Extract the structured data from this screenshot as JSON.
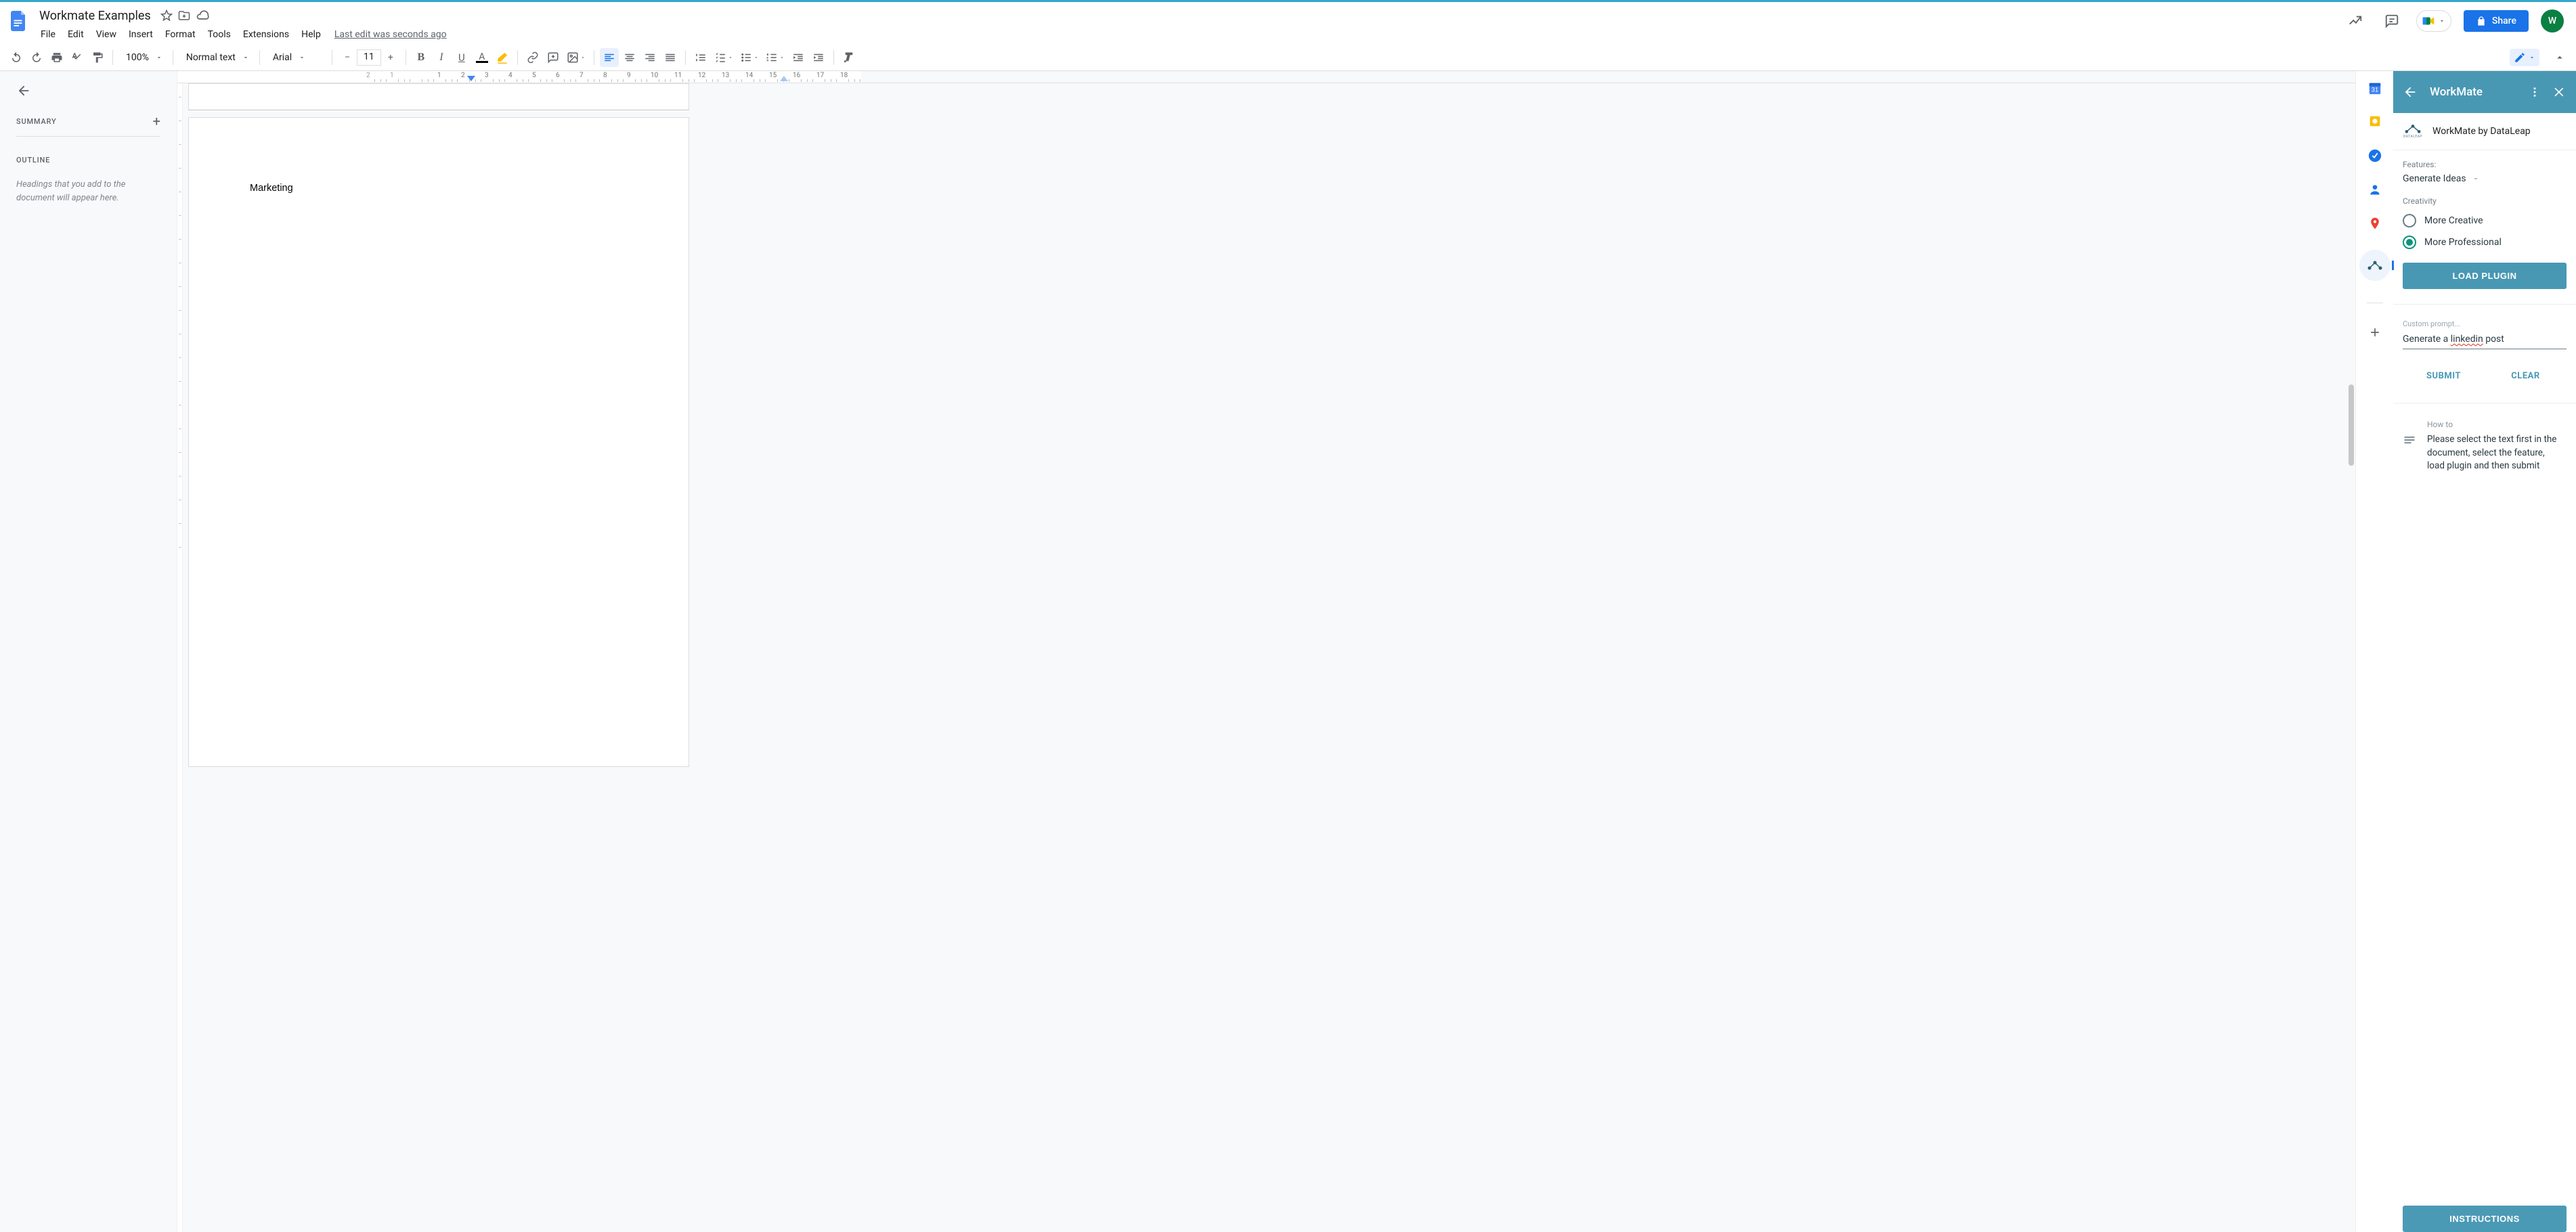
{
  "header": {
    "doc_title": "Workmate Examples",
    "menus": [
      "File",
      "Edit",
      "View",
      "Insert",
      "Format",
      "Tools",
      "Extensions",
      "Help"
    ],
    "last_edit": "Last edit was seconds ago",
    "share_label": "Share",
    "avatar_initial": "W"
  },
  "toolbar": {
    "zoom": "100%",
    "style": "Normal text",
    "font": "Arial",
    "font_size": "11"
  },
  "ruler": {
    "labels": [
      "2",
      "1",
      "",
      "1",
      "2",
      "3",
      "4",
      "5",
      "6",
      "7",
      "8",
      "9",
      "10",
      "11",
      "12",
      "13",
      "14",
      "15",
      "16",
      "17",
      "18"
    ]
  },
  "outline": {
    "summary_label": "SUMMARY",
    "outline_label": "OUTLINE",
    "hint": "Headings that you add to the document will appear here."
  },
  "document": {
    "body_text": "Marketing"
  },
  "rail": {
    "items": [
      "calendar",
      "keep",
      "tasks",
      "contacts",
      "maps",
      "workmate",
      "add"
    ]
  },
  "addon": {
    "panel_title": "WorkMate",
    "brand_title": "WorkMate by DataLeap",
    "features_label": "Features:",
    "features_value": "Generate Ideas",
    "creativity_label": "Creativity",
    "opt_creative": "More Creative",
    "opt_professional": "More Professional",
    "load_btn": "LOAD PLUGIN",
    "prompt_label": "Custom prompt...",
    "prompt_value_prefix": "Generate a ",
    "prompt_value_mis": "linkedin",
    "prompt_value_suffix": " post",
    "submit": "SUBMIT",
    "clear": "CLEAR",
    "howto_title": "How to",
    "howto_text": "Please select the text first in the document, select the feature, load plugin and then submit",
    "instructions_btn": "INSTRUCTIONS"
  }
}
